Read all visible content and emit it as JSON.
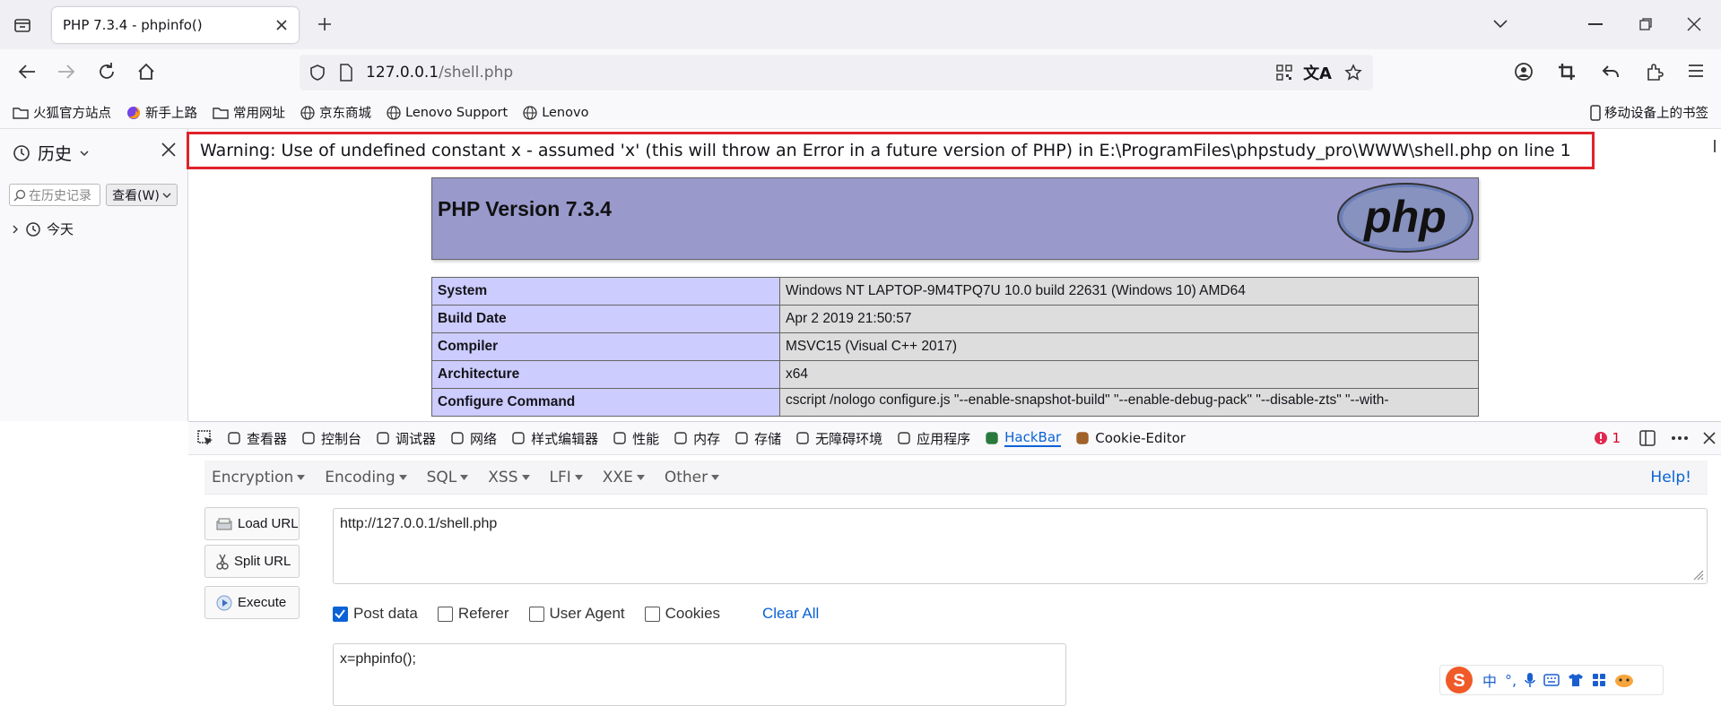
{
  "tab": {
    "title": "PHP 7.3.4 - phpinfo()"
  },
  "address": {
    "host": "127.0.0.1",
    "path": "/shell.php"
  },
  "bookmarks": [
    {
      "label": "火狐官方站点",
      "icon": "folder-icon"
    },
    {
      "label": "新手上路",
      "icon": "firefox-icon"
    },
    {
      "label": "常用网址",
      "icon": "folder-icon"
    },
    {
      "label": "京东商城",
      "icon": "globe-icon"
    },
    {
      "label": "Lenovo Support",
      "icon": "globe-icon"
    },
    {
      "label": "Lenovo",
      "icon": "globe-icon"
    }
  ],
  "mobile_bookmarks": "移动设备上的书签",
  "sidebar": {
    "title": "历史",
    "search_placeholder": "在历史记录",
    "view_button": "查看(W)",
    "today": "今天"
  },
  "page": {
    "warning": "Warning: Use of undefined constant x - assumed 'x' (this will throw an Error in a future version of PHP) in E:\\ProgramFiles\\phpstudy_pro\\WWW\\shell.php on line 1",
    "php_title": "PHP Version 7.3.4",
    "php_logo": "php",
    "rows": [
      {
        "key": "System",
        "value": "Windows NT LAPTOP-9M4TPQ7U 10.0 build 22631 (Windows 10) AMD64"
      },
      {
        "key": "Build Date",
        "value": "Apr 2 2019 21:50:57"
      },
      {
        "key": "Compiler",
        "value": "MSVC15 (Visual C++ 2017)"
      },
      {
        "key": "Architecture",
        "value": "x64"
      },
      {
        "key": "Configure Command",
        "value": "cscript /nologo configure.js \"--enable-snapshot-build\" \"--enable-debug-pack\" \"--disable-zts\" \"--with-"
      }
    ]
  },
  "devtools": {
    "tabs": [
      "查看器",
      "控制台",
      "调试器",
      "网络",
      "样式编辑器",
      "性能",
      "内存",
      "存储",
      "无障碍环境",
      "应用程序",
      "HackBar",
      "Cookie-Editor"
    ],
    "error_count": "1"
  },
  "hackbar": {
    "menus": [
      "Encryption",
      "Encoding",
      "SQL",
      "XSS",
      "LFI",
      "XXE",
      "Other"
    ],
    "help": "Help!",
    "buttons": [
      "Load URL",
      "Split URL",
      "Execute"
    ],
    "url": "http://127.0.0.1/shell.php",
    "options": [
      {
        "label": "Post data",
        "checked": true
      },
      {
        "label": "Referer",
        "checked": false
      },
      {
        "label": "User Agent",
        "checked": false
      },
      {
        "label": "Cookies",
        "checked": false
      }
    ],
    "clear_all": "Clear All",
    "post_body": "x=phpinfo();"
  },
  "ime": {
    "lang": "中",
    "punct": "°,"
  },
  "colors": {
    "warning_border": "#e0222a",
    "php_header": "#9999cc",
    "php_key": "#ccccff",
    "php_value": "#dddddd",
    "link_blue": "#0a62d6",
    "hackbar_tab": "#0a62d6"
  }
}
